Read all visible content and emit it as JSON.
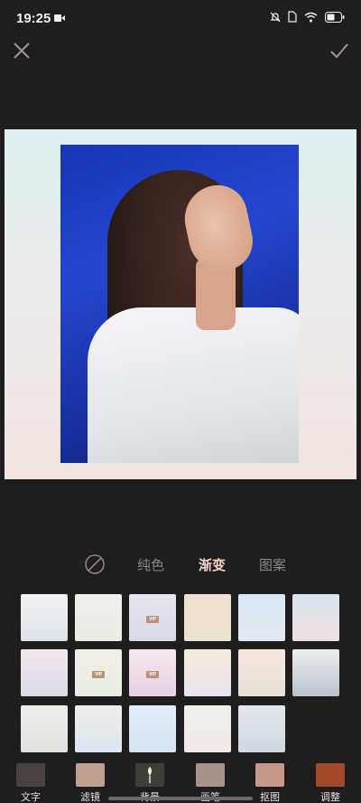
{
  "status_bar": {
    "time": "19:25",
    "icons": [
      "camera-icon",
      "mute-icon",
      "sim-icon",
      "wifi-icon",
      "battery-icon"
    ]
  },
  "top_bar": {
    "close_icon": "close-icon",
    "confirm_icon": "check-icon"
  },
  "tabs": {
    "none_icon": "no-background-icon",
    "items": [
      "纯色",
      "渐变",
      "图案"
    ],
    "selected": "渐变",
    "selected_color": "#f0d2c6"
  },
  "swatches": {
    "badge_text": "VIP",
    "rows": [
      [
        {
          "from": "#f0f1f4",
          "to": "#dfe3ea",
          "vip": false
        },
        {
          "from": "#eef0ea",
          "to": "#e9ece3",
          "vip": false
        },
        {
          "from": "#e7e4ee",
          "to": "#d9dbe9",
          "vip": true
        },
        {
          "from": "#f1e0d2",
          "to": "#eee3cf",
          "vip": false
        },
        {
          "from": "#d8e7f4",
          "to": "#e3e9f2",
          "vip": false
        },
        {
          "from": "#d9e4ef",
          "to": "#f0dfe0",
          "vip": false
        }
      ],
      [
        {
          "from": "#f3e6ee",
          "to": "#dcdbe9",
          "vip": false
        },
        {
          "from": "#f2efe6",
          "to": "#e7ede3",
          "vip": true
        },
        {
          "from": "#f4e7f0",
          "to": "#e9d2e2",
          "vip": true
        },
        {
          "from": "#f7ecd9",
          "to": "#e8e3f0",
          "vip": false
        },
        {
          "from": "#f6e6dd",
          "to": "#e9e1d6",
          "vip": false
        },
        {
          "from": "#eceeef",
          "to": "#b9c3cf",
          "vip": false
        }
      ],
      [
        {
          "from": "#edeeec",
          "to": "#dfe2de",
          "vip": false
        },
        {
          "from": "#f1ece8",
          "to": "#d9e6f4",
          "vip": false
        },
        {
          "from": "#e2eef8",
          "to": "#d6e4f1",
          "vip": false
        },
        {
          "from": "#f0efed",
          "to": "#f1e9e7",
          "vip": false
        },
        {
          "from": "#e3e7ec",
          "to": "#cfd9e2",
          "vip": false
        }
      ]
    ]
  },
  "toolbar": {
    "items": [
      {
        "label": "文字",
        "color": "#4a4141",
        "icon": "text-icon"
      },
      {
        "label": "滤镜",
        "color": "#c0a191",
        "icon": "filter-icon"
      },
      {
        "label": "背景",
        "color": "#3d4036",
        "icon": "background-icon"
      },
      {
        "label": "画笔",
        "color": "#a7938a",
        "icon": "brush-icon"
      },
      {
        "label": "抠图",
        "color": "#c6988a",
        "icon": "cutout-icon"
      },
      {
        "label": "调整",
        "color": "#a24a2a",
        "icon": "adjust-icon"
      }
    ]
  }
}
